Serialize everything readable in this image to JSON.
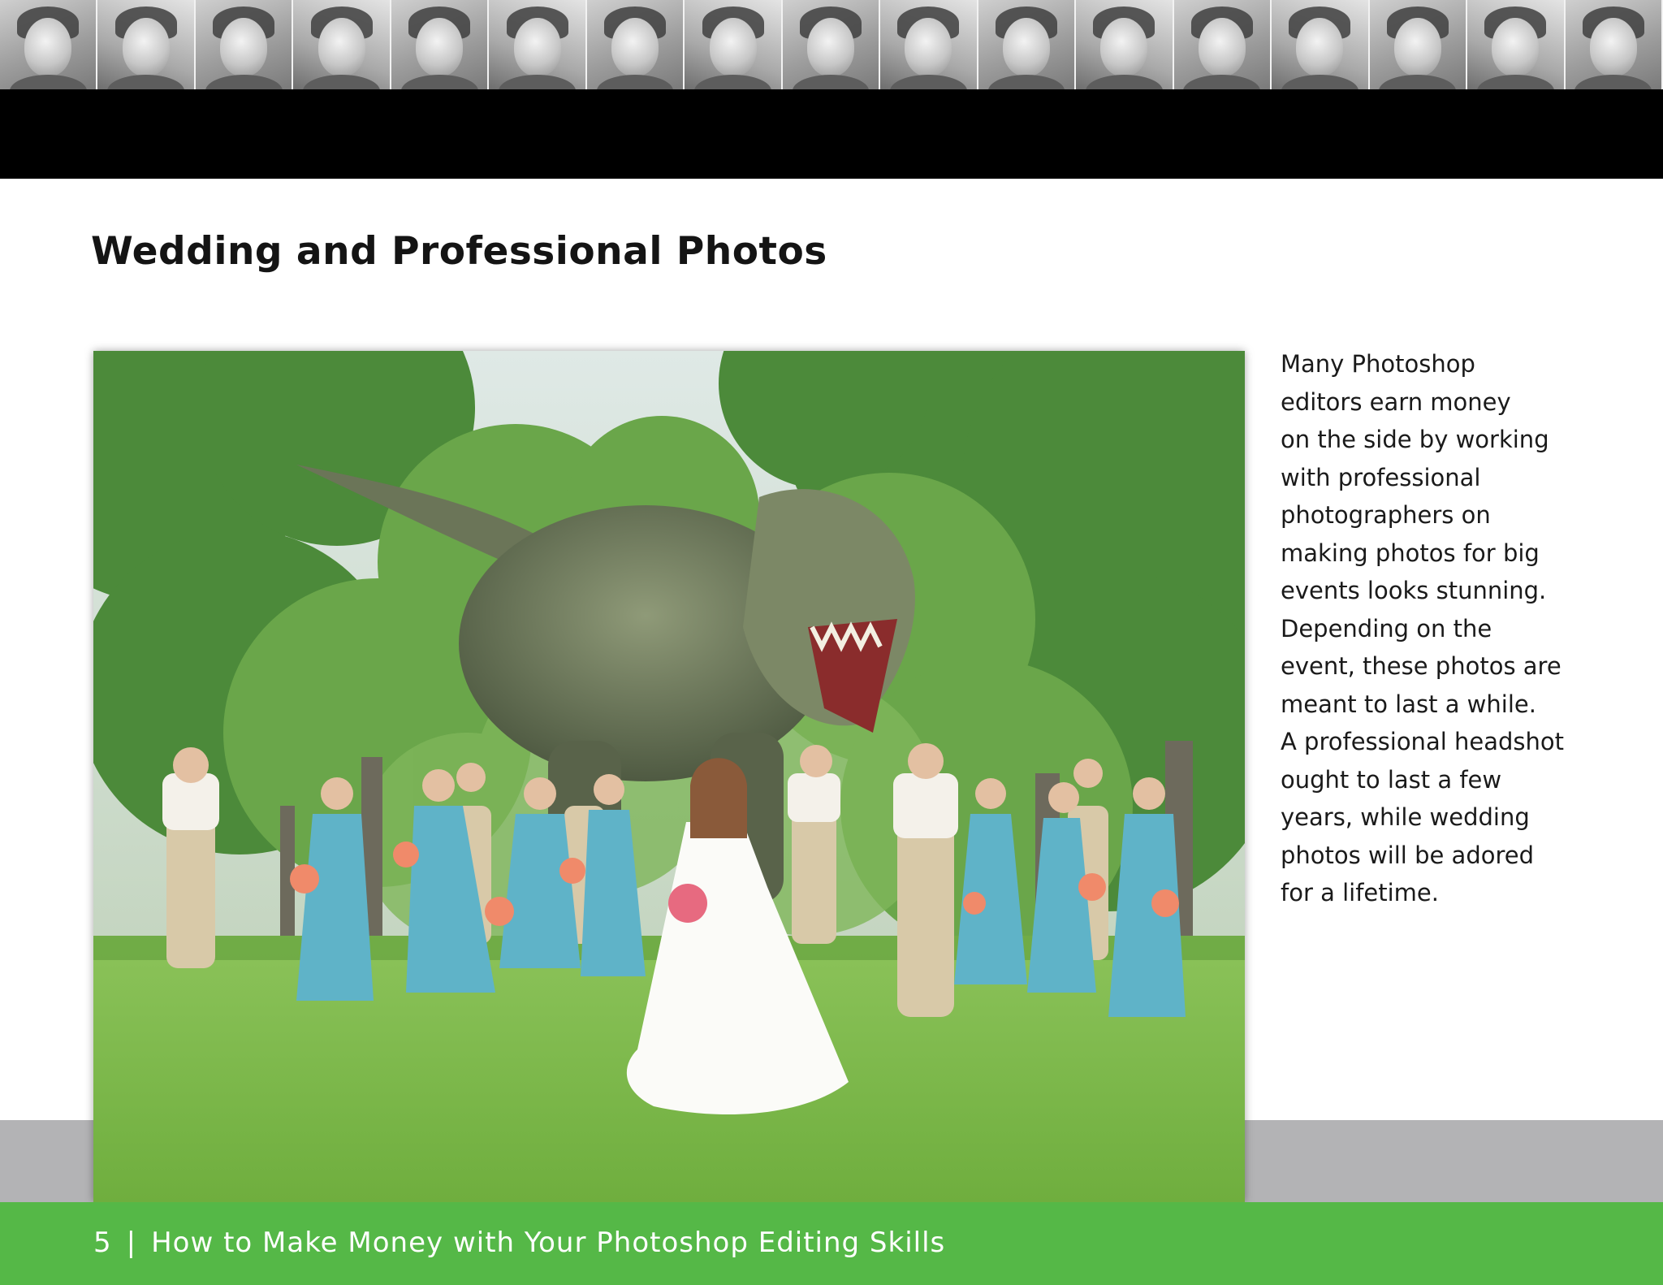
{
  "header": {
    "portrait_strip": {
      "portrait_count": 17,
      "icon": "portrait-photo"
    }
  },
  "section": {
    "title": "Wedding and Professional Photos"
  },
  "photo": {
    "icon": "wedding-party-dinosaur-photo"
  },
  "body": {
    "lines": [
      "Many Photoshop",
      "editors earn money",
      "on the side by working",
      "with professional",
      "photographers on",
      "making photos for big",
      "events looks stunning.",
      "Depending on the",
      "event, these photos are",
      "meant to last a while.",
      "A professional headshot",
      "ought to last a few",
      "years, while wedding",
      "photos will be adored",
      "for a lifetime."
    ]
  },
  "footer": {
    "page_number": "5",
    "separator": "|",
    "title": "How to Make Money with Your Photoshop Editing Skills"
  },
  "colors": {
    "footer_green": "#55b847",
    "header_black": "#000000",
    "grey_band": "#b3b3b5",
    "dress_blue": "#5fb3c8"
  }
}
